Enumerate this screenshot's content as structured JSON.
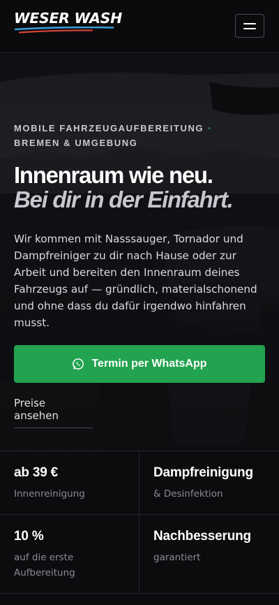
{
  "brand": {
    "name": "WESER WASH",
    "stripe_colors": [
      "#3a9bd8",
      "#d8453a"
    ]
  },
  "header": {
    "menu_icon": "hamburger-menu-icon"
  },
  "hero": {
    "eyebrow_line1": "MOBILE FAHRZEUGAUFBEREITUNG",
    "eyebrow_dot": "·",
    "eyebrow_line2": "BREMEN & UMGEBUNG",
    "headline_1": "Innenraum wie neu.",
    "headline_2": "Bei dir in der Einfahrt.",
    "lead": "Wir kommen mit Nasssauger, Tornador und Dampfreiniger zu dir nach Hause oder zur Arbeit und bereiten den Innenraum deines Fahrzeugs auf — gründlich, materialschonend und ohne dass du dafür irgendwo hinfahren musst.",
    "cta_label": "Termin per WhatsApp",
    "cta_icon": "whatsapp-icon",
    "cta_color": "#22a34f",
    "secondary_link": "Preise ansehen"
  },
  "stats": [
    {
      "value": "ab 39 €",
      "label": "Innenreinigung"
    },
    {
      "value": "Dampfreinigung",
      "label": "& Desinfektion"
    },
    {
      "value": "10 %",
      "label": "auf die erste Aufbereitung"
    },
    {
      "value": "Nachbesserung",
      "label": "garantiert"
    }
  ]
}
